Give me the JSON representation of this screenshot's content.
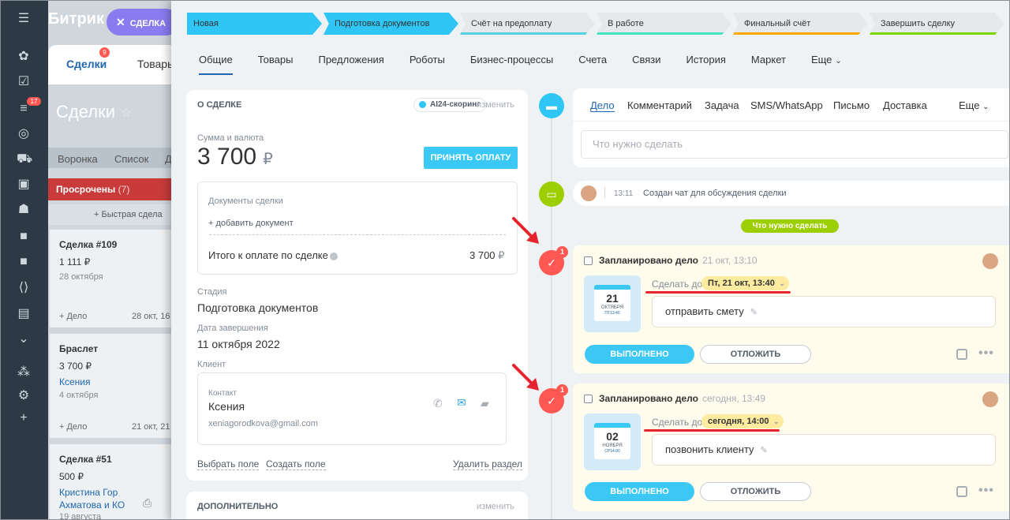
{
  "background": {
    "logo": "Битрик",
    "chip_label": "СДЕЛКА",
    "tabs": [
      "Сделки",
      "Товары"
    ],
    "tab_badge": "9",
    "sidebar_badge": "17",
    "page_title": "Сделки",
    "views": [
      "Воронка",
      "Список",
      "Д"
    ],
    "overdue": "Просрочены",
    "overdue_count": "(7)",
    "quick_add": "Быстрая сдела",
    "cards": [
      {
        "title": "Сделка #109",
        "price": "1 111 ₽",
        "date": "28 октября",
        "footer": "+ Дело",
        "footer_date": "28 окт, 16"
      },
      {
        "title": "Браслет",
        "price": "3 700 ₽",
        "contact": "Ксения",
        "date": "4 октября",
        "footer": "+ Дело",
        "footer_date": "21 окт, 21"
      },
      {
        "title": "Сделка #51",
        "price": "500 ₽",
        "contact": "Кристина Гор",
        "contact2": "Ахматова и КО",
        "date": "19 августа"
      }
    ]
  },
  "stages": [
    {
      "label": "Новая",
      "color": "#2fc6f6"
    },
    {
      "label": "Подготовка документов",
      "color": "#2fc6f6"
    },
    {
      "label": "Счёт на предоплату",
      "color": "#55d0e0"
    },
    {
      "label": "В работе",
      "color": "#47e4c2"
    },
    {
      "label": "Финальный счёт",
      "color": "#ffa900"
    },
    {
      "label": "Завершить сделку",
      "color": "#7bd500"
    }
  ],
  "tabs": [
    "Общие",
    "Товары",
    "Предложения",
    "Роботы",
    "Бизнес-процессы",
    "Счета",
    "Связи",
    "История",
    "Маркет",
    "Еще"
  ],
  "about": {
    "header": "О СДЕЛКЕ",
    "ai_label": "AI24-скоринг",
    "edit": "изменить",
    "sum_label": "Сумма и валюта",
    "amount": "3 700",
    "currency": "₽",
    "pay_button": "ПРИНЯТЬ ОПЛАТУ",
    "docs_label": "Документы сделки",
    "add_doc": "+ добавить документ",
    "total_label": "Итого к оплате по сделке",
    "total_value": "3 700",
    "total_currency": "₽",
    "stage_label": "Стадия",
    "stage_value": "Подготовка документов",
    "close_label": "Дата завершения",
    "close_value": "11 октября 2022",
    "client_label": "Клиент",
    "contact_label": "Контакт",
    "contact_name": "Ксения",
    "contact_email": "xeniagorodkova@gmail.com",
    "select_field": "Выбрать поле",
    "create_field": "Создать поле",
    "delete_section": "Удалить раздел"
  },
  "extra": {
    "header": "ДОПОЛНИТЕЛЬНО",
    "edit": "изменить"
  },
  "editor": {
    "tabs": [
      "Дело",
      "Комментарий",
      "Задача",
      "SMS/WhatsApp",
      "Письмо",
      "Доставка"
    ],
    "more": "Еще",
    "placeholder": "Что нужно сделать"
  },
  "chat_event": {
    "time": "13:11",
    "text": "Создан чат для обсуждения сделки"
  },
  "todo_pill": "Что нужно сделать",
  "tasks": [
    {
      "badge": "1",
      "title": "Запланировано дело",
      "time": "21 окт, 13:10",
      "cal_day": "21",
      "cal_month": "ОКТЯБРЯ",
      "cal_week": "ПТ13:40",
      "due_label": "Сделать до",
      "due_value": "Пт, 21 окт, 13:40",
      "description": "отправить смету",
      "done": "ВЫПОЛНЕНО",
      "later": "ОТЛОЖИТЬ"
    },
    {
      "badge": "1",
      "title": "Запланировано дело",
      "time": "сегодня, 13:49",
      "cal_day": "02",
      "cal_month": "НОЯБРЯ",
      "cal_week": "СР14:00",
      "due_label": "Сделать до",
      "due_value": "сегодня, 14:00",
      "description": "позвонить клиенту",
      "done": "ВЫПОЛНЕНО",
      "later": "ОТЛОЖИТЬ"
    }
  ]
}
